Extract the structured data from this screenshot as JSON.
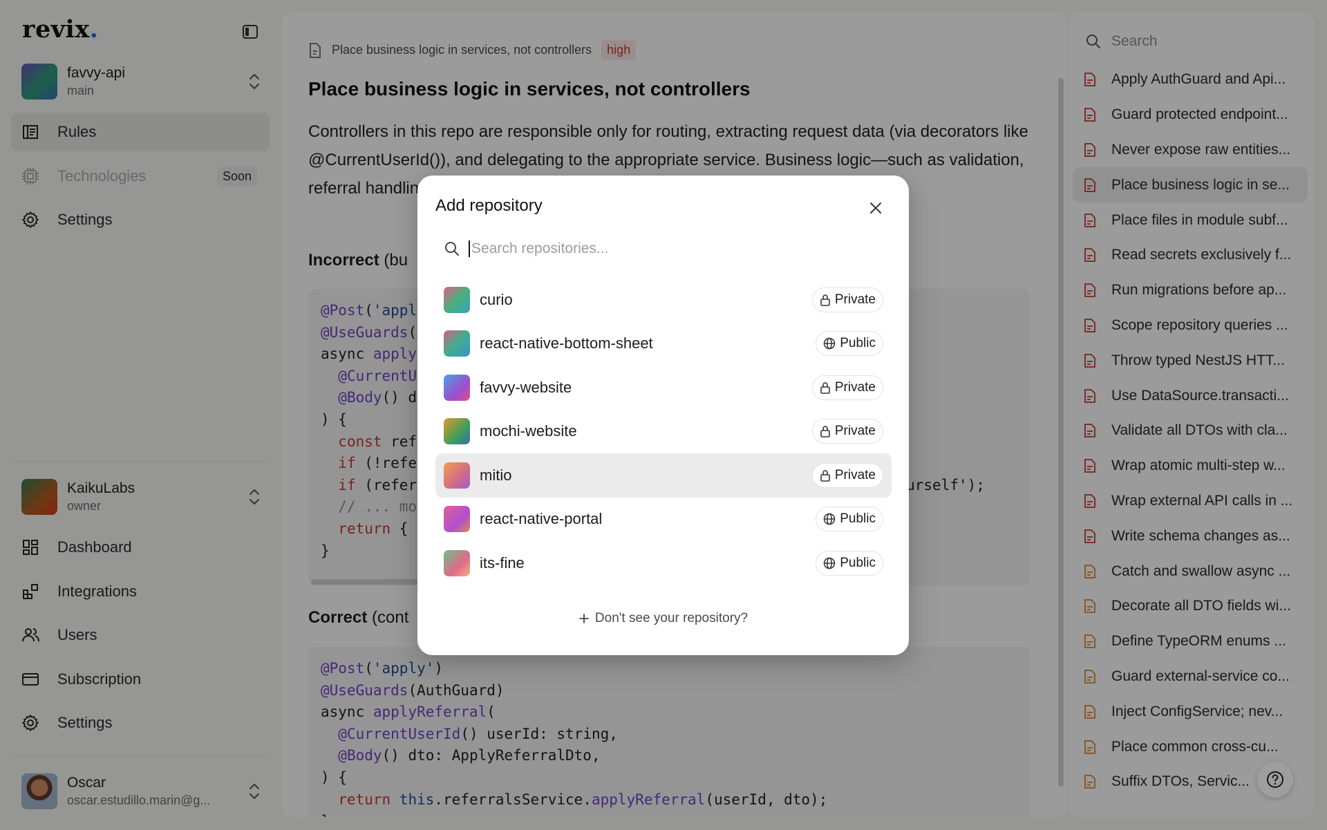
{
  "app": {
    "logo": "revix",
    "logo_dot": "."
  },
  "workspace": {
    "name": "favvy-api",
    "branch": "main"
  },
  "nav_top": [
    {
      "label": "Rules",
      "icon": "book-icon"
    },
    {
      "label": "Technologies",
      "icon": "chip-icon",
      "badge": "Soon"
    },
    {
      "label": "Settings",
      "icon": "gear-icon"
    }
  ],
  "org": {
    "name": "KaikuLabs",
    "role": "owner"
  },
  "nav_bottom": [
    {
      "label": "Dashboard",
      "icon": "grid-icon"
    },
    {
      "label": "Integrations",
      "icon": "integrations-icon"
    },
    {
      "label": "Users",
      "icon": "users-icon"
    },
    {
      "label": "Subscription",
      "icon": "card-icon"
    },
    {
      "label": "Settings",
      "icon": "gear-icon"
    }
  ],
  "user": {
    "name": "Oscar",
    "email": "oscar.estudillo.marin@g..."
  },
  "rule": {
    "breadcrumb": "Place business logic in services, not controllers",
    "severity": "high",
    "title": "Place business logic in services, not controllers",
    "description": "Controllers in this repo are responsible only for routing, extracting request data (via decorators like @CurrentUserId()), and delegating to the appropriate service. Business logic—such as validation, referral handling and domain invariants—must live in the service layer.",
    "incorrect_label": "Incorrect",
    "incorrect_note": "(bu",
    "correct_label": "Correct",
    "correct_note": "(cont"
  },
  "right_panel": {
    "search_placeholder": "Search",
    "items": [
      {
        "label": "Apply AuthGuard and Api...",
        "level": "high"
      },
      {
        "label": "Guard protected endpoint...",
        "level": "high"
      },
      {
        "label": "Never expose raw entities...",
        "level": "high"
      },
      {
        "label": "Place business logic in se...",
        "level": "high",
        "active": true
      },
      {
        "label": "Place files in module subf...",
        "level": "high"
      },
      {
        "label": "Read secrets exclusively f...",
        "level": "high"
      },
      {
        "label": "Run migrations before ap...",
        "level": "high"
      },
      {
        "label": "Scope repository queries ...",
        "level": "high"
      },
      {
        "label": "Throw typed NestJS HTT...",
        "level": "high"
      },
      {
        "label": "Use DataSource.transacti...",
        "level": "high"
      },
      {
        "label": "Validate all DTOs with cla...",
        "level": "high"
      },
      {
        "label": "Wrap atomic multi-step w...",
        "level": "high"
      },
      {
        "label": "Wrap external API calls in ...",
        "level": "high"
      },
      {
        "label": "Write schema changes as...",
        "level": "high"
      },
      {
        "label": "Catch and swallow async ...",
        "level": "medium"
      },
      {
        "label": "Decorate all DTO fields wi...",
        "level": "medium"
      },
      {
        "label": "Define TypeORM enums ...",
        "level": "medium"
      },
      {
        "label": "Guard external-service co...",
        "level": "medium"
      },
      {
        "label": "Inject ConfigService; nev...",
        "level": "medium"
      },
      {
        "label": "Place common cross-cu...",
        "level": "medium"
      },
      {
        "label": "Suffix DTOs, Servic...",
        "level": "medium"
      }
    ]
  },
  "modal": {
    "title": "Add repository",
    "search_placeholder": "Search repositories...",
    "repos": [
      {
        "name": "curio",
        "visibility": "Private"
      },
      {
        "name": "react-native-bottom-sheet",
        "visibility": "Public"
      },
      {
        "name": "favvy-website",
        "visibility": "Private"
      },
      {
        "name": "mochi-website",
        "visibility": "Private"
      },
      {
        "name": "mitio",
        "visibility": "Private"
      },
      {
        "name": "react-native-portal",
        "visibility": "Public"
      },
      {
        "name": "its-fine",
        "visibility": "Public"
      }
    ],
    "footer": "Don't see your repository?"
  },
  "colors": {
    "accent": "#2563eb",
    "high": "#c0392b",
    "medium": "#d9822b"
  }
}
